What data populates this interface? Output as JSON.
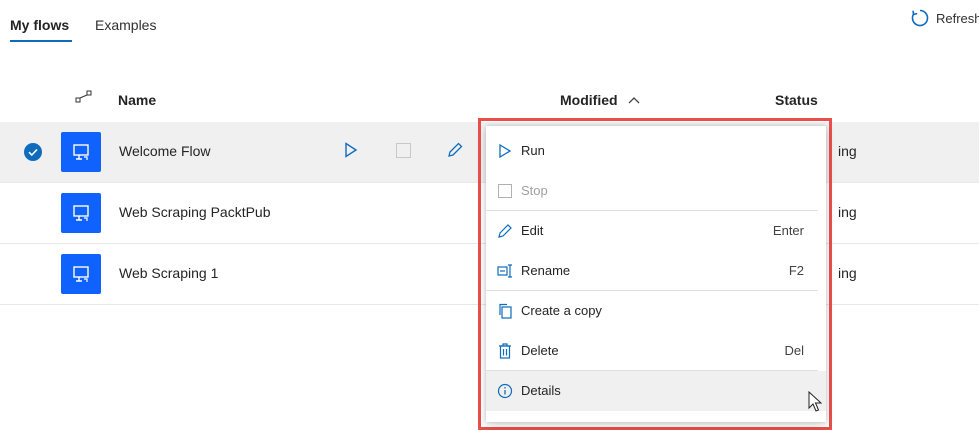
{
  "tabs": [
    {
      "label": "My flows",
      "active": true
    },
    {
      "label": "Examples",
      "active": false
    }
  ],
  "toolbar": {
    "refresh_label": "Refresh"
  },
  "table": {
    "columns": {
      "name": "Name",
      "modified": "Modified",
      "status": "Status"
    },
    "sort": {
      "column": "Modified",
      "direction": "ascending"
    },
    "rows": [
      {
        "name": "Welcome Flow",
        "status": "ing",
        "selected": true
      },
      {
        "name": "Web Scraping PacktPub",
        "status": "ing",
        "selected": false
      },
      {
        "name": "Web Scraping 1",
        "status": "ing",
        "selected": false
      }
    ]
  },
  "context_menu": {
    "items": [
      {
        "label": "Run",
        "shortcut": "",
        "icon": "play-icon",
        "disabled": false
      },
      {
        "label": "Stop",
        "shortcut": "",
        "icon": "stop-icon",
        "disabled": true
      },
      {
        "label": "Edit",
        "shortcut": "Enter",
        "icon": "pencil-icon",
        "disabled": false
      },
      {
        "label": "Rename",
        "shortcut": "F2",
        "icon": "rename-icon",
        "disabled": false
      },
      {
        "label": "Create a copy",
        "shortcut": "",
        "icon": "copy-icon",
        "disabled": false
      },
      {
        "label": "Delete",
        "shortcut": "Del",
        "icon": "trash-icon",
        "disabled": false
      },
      {
        "label": "Details",
        "shortcut": "",
        "icon": "info-icon",
        "disabled": false,
        "hovered": true
      }
    ]
  },
  "colors": {
    "accent": "#0f6cbd",
    "flow_icon_bg": "#0f62fe",
    "highlight_outline": "#e94f4a",
    "selected_row": "#f0f0f0"
  }
}
